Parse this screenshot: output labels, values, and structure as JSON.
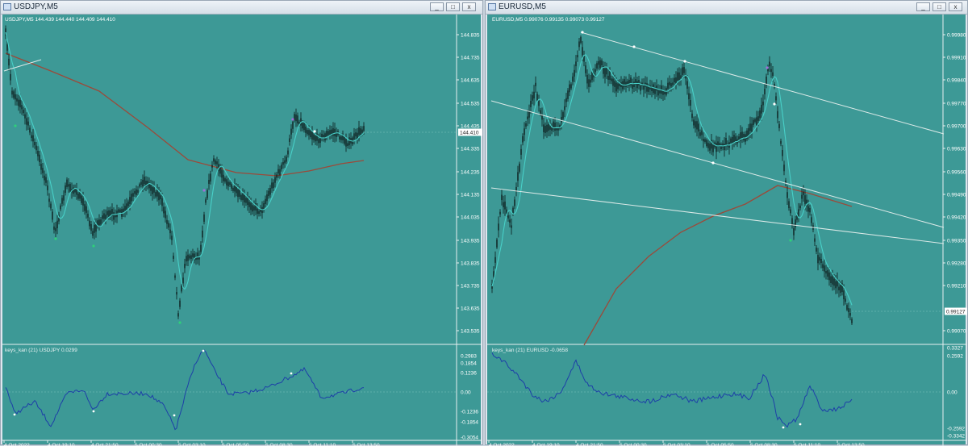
{
  "colors": {
    "chart_bg": "#3d9996",
    "candles": "#0b1a1a",
    "fast_ma": "#48d0c8",
    "slow_ma": "#9b4a3a",
    "indicator_line": "#1d3fa8",
    "trendline": "#dceae8",
    "price_tag_bg": "#ffffff"
  },
  "left_window": {
    "title": "USDJPY,M5",
    "main_header": "USDJPY,M5  144.439 144.440 144.409 144.410",
    "current_price": "144.410",
    "price_scale": [
      "144.835",
      "144.735",
      "144.635",
      "144.535",
      "144.435",
      "144.335",
      "144.235",
      "144.135",
      "144.035",
      "143.935",
      "143.835",
      "143.735",
      "143.635",
      "143.535"
    ],
    "indicator_header": "keys_kan (21) USDJPY 0.0299",
    "indicator_scale": [
      "0.2983",
      "0.1854",
      "0.1236",
      "0.00",
      "-0.1236",
      "-0.1854",
      "-0.3054"
    ],
    "time_labels": [
      "4 Oct 2022",
      "4 Oct 19:10",
      "4 Oct 21:50",
      "5 Oct 00:30",
      "5 Oct 03:10",
      "5 Oct 05:50",
      "5 Oct 08:30",
      "5 Oct 11:10",
      "5 Oct 13:50"
    ]
  },
  "right_window": {
    "title": "EURUSD,M5",
    "main_header": "EURUSD,M5  0.99076 0.99135 0.99073 0.99127",
    "current_price": "0.99127",
    "price_scale": [
      "0.99980",
      "0.99910",
      "0.99840",
      "0.99770",
      "0.99700",
      "0.99630",
      "0.99560",
      "0.99490",
      "0.99420",
      "0.99350",
      "0.99280",
      "0.99210",
      "0.99070"
    ],
    "indicator_header": "keys_kan (21) EURUSD -0.0658",
    "indicator_scale": [
      "0.3327",
      "0.2592",
      "0.00",
      "-0.2592",
      "-0.3342"
    ],
    "time_labels": [
      "4 Oct 2022",
      "4 Oct 19:10",
      "4 Oct 21:50",
      "5 Oct 00:30",
      "5 Oct 03:10",
      "5 Oct 05:50",
      "5 Oct 08:30",
      "5 Oct 11:10",
      "5 Oct 13:50"
    ]
  },
  "window_buttons": {
    "minimize": "_",
    "maximize": "□",
    "close": "x"
  }
}
